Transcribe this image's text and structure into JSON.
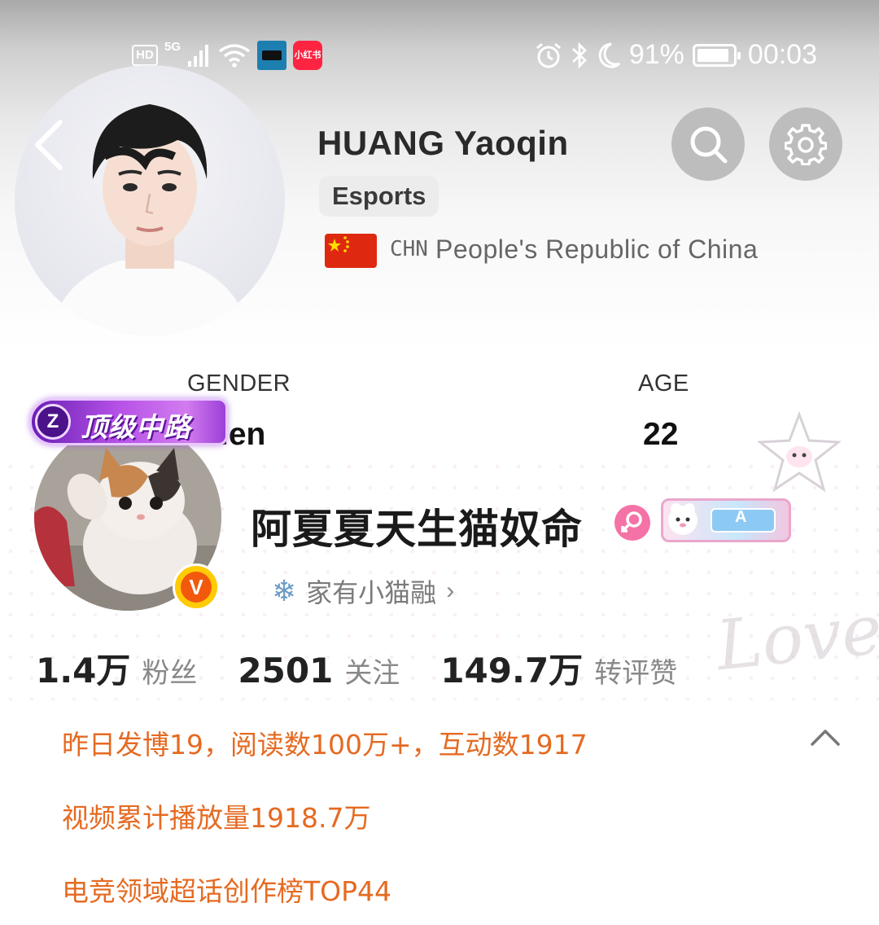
{
  "status_bar": {
    "hd": "HD",
    "network": "5G",
    "app2_label": "小红书",
    "battery_percent": "91%",
    "battery_level": 0.91,
    "clock": "00:03",
    "icons": [
      "signal-icon",
      "wifi-icon",
      "alarm-icon",
      "bluetooth-icon",
      "moon-icon",
      "battery-icon"
    ]
  },
  "player": {
    "name": "HUANG Yaoqin",
    "sport": "Esports",
    "country_code": "CHN",
    "country_name": "People's Republic of China",
    "gender_label": "GENDER",
    "gender_value": "len",
    "age_label": "AGE",
    "age_value": "22"
  },
  "weibo": {
    "rank_badge": "顶级中路",
    "rank_icon": "Z",
    "verified": "V",
    "name": "阿夏夏天生猫奴命",
    "member_letter": "A",
    "sub_label": "家有小猫融",
    "stats": [
      {
        "value": "1.4万",
        "unit": "粉丝"
      },
      {
        "value": "2501",
        "unit": "关注"
      },
      {
        "value": "149.7万",
        "unit": "转评赞"
      }
    ],
    "insights": [
      "昨日发博19，阅读数100万+，互动数1917",
      "视频累计播放量1918.7万",
      "电竞领域超话创作榜TOP44"
    ],
    "decor_text": "Lovely"
  },
  "colors": {
    "accent_orange": "#e56a21",
    "rank_purple": "#b651e6",
    "gender_pink": "#f472a6",
    "verified_orange": "#f2590d"
  }
}
